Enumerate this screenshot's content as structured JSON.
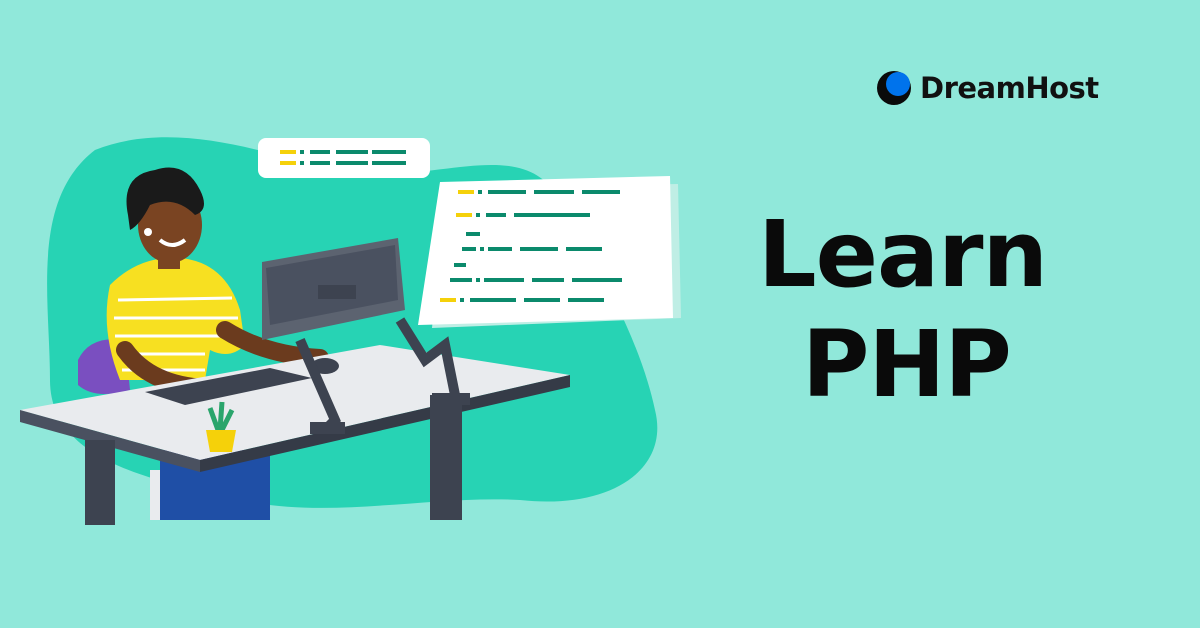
{
  "brand": {
    "name": "DreamHost"
  },
  "headline": {
    "line1": "Learn",
    "line2": "PHP"
  },
  "colors": {
    "background": "#90e8da",
    "blob": "#27d3b4",
    "code_yellow": "#f5d10a",
    "code_green": "#0b8a6c",
    "brand_blue": "#0073ec",
    "shirt": "#f7e021"
  },
  "icons": {
    "logo": "dreamhost-moon-icon",
    "code_card_small": "code-snippet-card",
    "code_card_large": "code-editor-card"
  }
}
